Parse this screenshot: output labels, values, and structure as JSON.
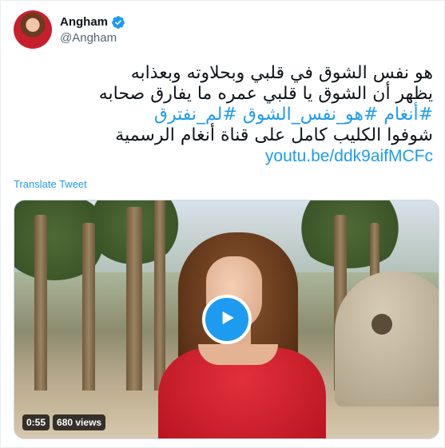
{
  "author": {
    "display_name": "Angham",
    "handle": "@Angham",
    "verified": true,
    "verified_icon": "verified-badge-icon"
  },
  "tweet": {
    "line1": "هو نفس الشوق في قلبي وبحلاوته وبعذابه",
    "line2": "يظهر أن الشوق يا قلبي عمره ما يفارق صحابه",
    "hashtags": [
      "#أنغام",
      "#هو_نفس_الشوق",
      "#لم_نفترق"
    ],
    "line4": "شوفوا الكليب كامل على قناة أنغام الرسمية",
    "url": "youtu.be/ddk9aifMCFc"
  },
  "translate_label": "Translate Tweet",
  "media": {
    "type": "video",
    "duration": "0:55",
    "views": "680 views",
    "play_icon": "play-icon"
  },
  "colors": {
    "link": "#1d9bf0",
    "text": "#0f1419",
    "secondary": "#536471"
  }
}
